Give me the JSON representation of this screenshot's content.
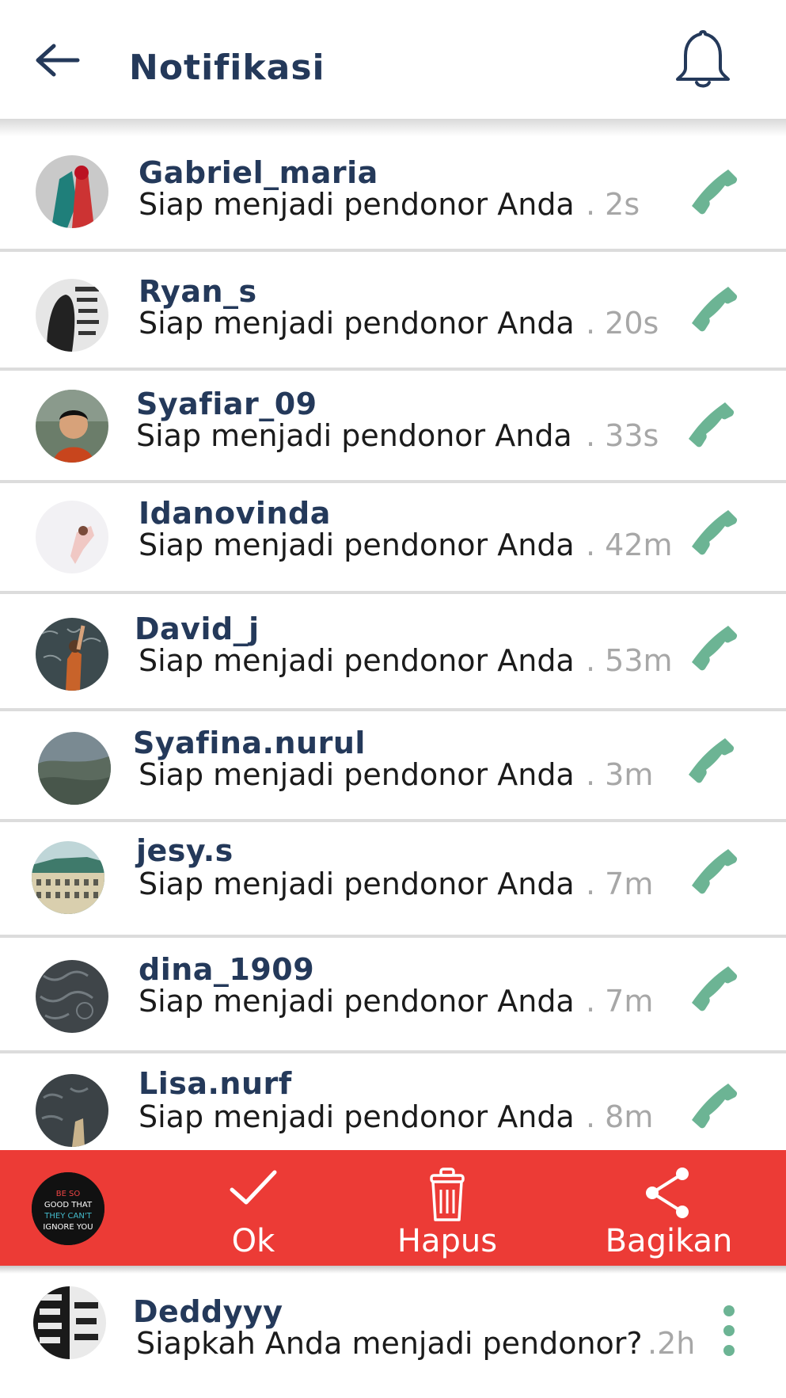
{
  "header": {
    "title": "Notifikasi"
  },
  "colors": {
    "accent_red": "#ec3b36",
    "call_green": "#6cb494",
    "title_navy": "#24395a",
    "time_gray": "#a7a7a7"
  },
  "icons": {
    "back": "arrow-left-icon",
    "bell": "bell-icon",
    "call": "phone-icon",
    "ok": "checkmark-icon",
    "delete": "trash-icon",
    "share": "share-icon",
    "more": "more-vertical-icon"
  },
  "notifications": [
    {
      "name": "Gabriel_maria",
      "message": "Siap menjadi pendonor Anda",
      "time": ". 2s"
    },
    {
      "name": "Ryan_s",
      "message": "Siap menjadi pendonor Anda",
      "time": ". 20s"
    },
    {
      "name": "Syafiar_09",
      "message": "Siap menjadi pendonor Anda",
      "time": " . 33s"
    },
    {
      "name": "Idanovinda",
      "message": "Siap menjadi pendonor Anda",
      "time": ". 42m"
    },
    {
      "name": "David_j",
      "message": "Siap menjadi pendonor Anda",
      "time": ". 53m"
    },
    {
      "name": "Syafina.nurul",
      "message": "Siap menjadi pendonor Anda",
      "time": " . 3m"
    },
    {
      "name": "jesy.s",
      "message": "Siap menjadi pendonor Anda",
      "time": ". 7m"
    },
    {
      "name": "dina_1909",
      "message": "Siap menjadi pendonor Anda",
      "time": ". 7m"
    },
    {
      "name": "Lisa.nurf",
      "message": "Siap menjadi pendonor Anda",
      "time": " . 8m"
    }
  ],
  "action_bar": {
    "ok_label": "Ok",
    "delete_label": "Hapus",
    "share_label": "Bagikan",
    "avatar_art_text": "BE SO GOOD THAT THEY CAN'T IGNORE YOU"
  },
  "bottom_item": {
    "name": "Deddyyy",
    "message": "Siapkah Anda menjadi pendonor?",
    "time": " .2h"
  }
}
